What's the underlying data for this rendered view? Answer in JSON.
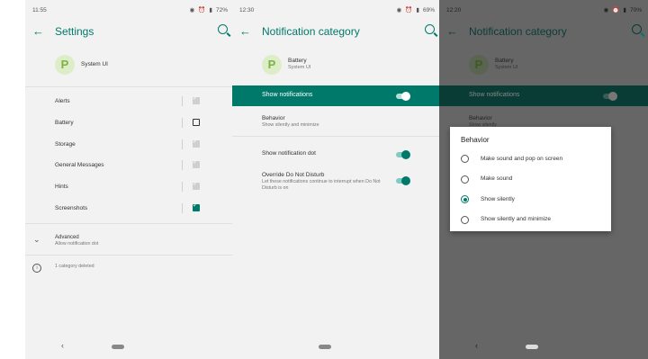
{
  "phone1": {
    "status_time": "11:55",
    "battery": "72%",
    "title": "Settings",
    "app_name": "System UI",
    "app_icon_letter": "P",
    "categories": [
      {
        "label": "Alerts",
        "state": "disabled"
      },
      {
        "label": "Battery",
        "state": "unchecked"
      },
      {
        "label": "Storage",
        "state": "disabled"
      },
      {
        "label": "General Messages",
        "state": "disabled"
      },
      {
        "label": "Hints",
        "state": "disabled"
      },
      {
        "label": "Screenshots",
        "state": "checked"
      }
    ],
    "advanced_title": "Advanced",
    "advanced_sub": "Allow notification dot",
    "deleted_text": "1 category deleted"
  },
  "phone2": {
    "status_time": "12:30",
    "battery": "69%",
    "title": "Notification category",
    "app_name": "Battery",
    "app_sub": "System UI",
    "app_icon_letter": "P",
    "show_notifications": "Show notifications",
    "behavior_title": "Behavior",
    "behavior_sub": "Show silently and minimize",
    "dot_label": "Show notification dot",
    "dnd_title": "Override Do Not Disturb",
    "dnd_sub": "Let these notifications continue to interrupt when Do Not Disturb is on"
  },
  "phone3": {
    "status_time": "12:20",
    "battery": "70%",
    "title": "Notification category",
    "app_name": "Battery",
    "app_sub": "System UI",
    "app_icon_letter": "P",
    "show_notifications": "Show notifications",
    "behavior_title": "Behavior",
    "behavior_sub": "Show silently",
    "dialog_title": "Behavior",
    "options": [
      {
        "label": "Make sound and pop on screen",
        "selected": false
      },
      {
        "label": "Make sound",
        "selected": false
      },
      {
        "label": "Show silently",
        "selected": true
      },
      {
        "label": "Show silently and minimize",
        "selected": false
      }
    ]
  },
  "icons": {
    "back": "←",
    "nav_back": "‹",
    "chevron": "⌄",
    "check": "✓",
    "info": "i"
  },
  "colors": {
    "accent": "#00796b",
    "screen_bg": "#f2f2f2"
  }
}
